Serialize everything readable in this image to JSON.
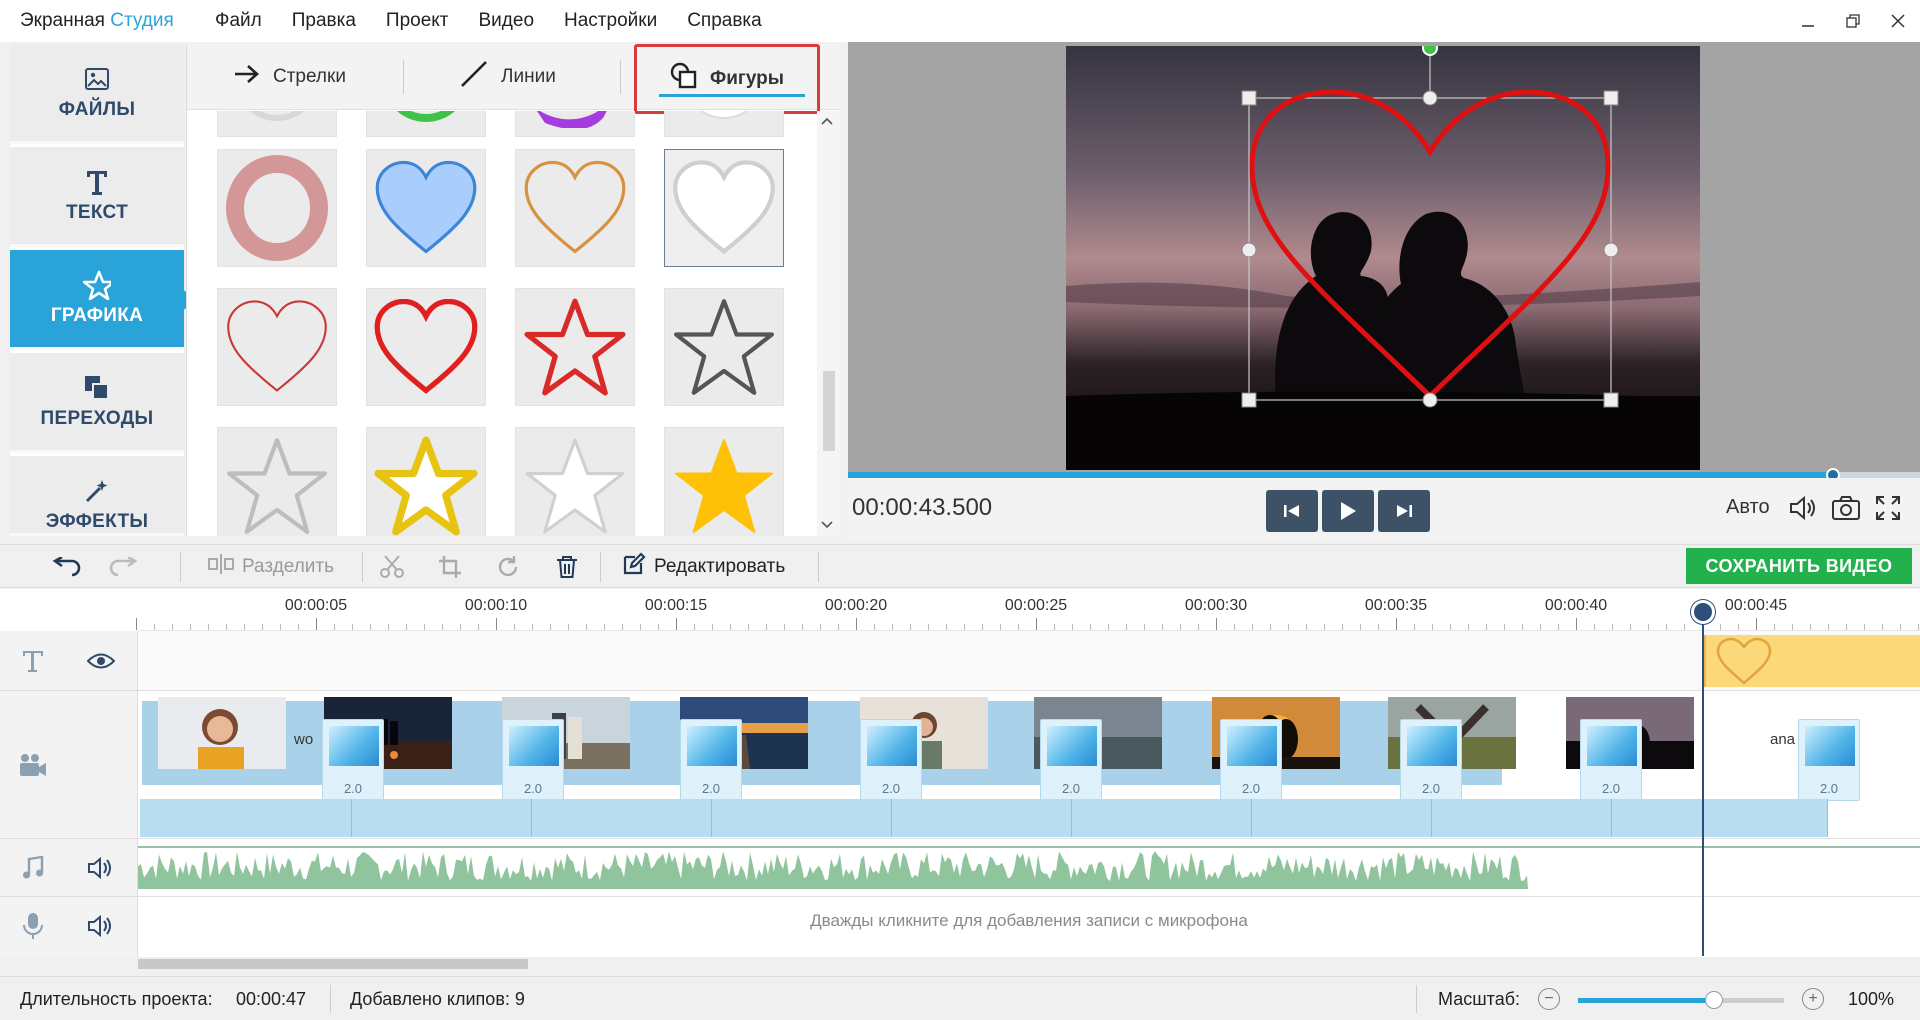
{
  "app": {
    "brand_main": "Экранная",
    "brand_accent": "Студия"
  },
  "menu": [
    "Файл",
    "Правка",
    "Проект",
    "Видео",
    "Настройки",
    "Справка"
  ],
  "sidebar": {
    "items": [
      {
        "label": "ФАЙЛЫ",
        "icon": "image-icon",
        "active": false
      },
      {
        "label": "ТЕКСТ",
        "icon": "text-icon",
        "active": false
      },
      {
        "label": "ГРАФИКА",
        "icon": "star-icon",
        "active": true
      },
      {
        "label": "ПЕРЕХОДЫ",
        "icon": "transitions-icon",
        "active": false
      },
      {
        "label": "ЭФФЕКТЫ",
        "icon": "magic-wand-icon",
        "active": false
      }
    ]
  },
  "graphics_tabs": [
    {
      "label": "Стрелки",
      "icon": "arrow-right-icon"
    },
    {
      "label": "Линии",
      "icon": "line-icon"
    },
    {
      "label": "Фигуры",
      "icon": "shapes-icon",
      "active": true
    }
  ],
  "preview": {
    "timecode": "00:00:43.500",
    "quality_label": "Авто",
    "progress": 0.919
  },
  "toolbar": {
    "split_label": "Разделить",
    "edit_label": "Редактировать",
    "save_label": "СОХРАНИТЬ ВИДЕО"
  },
  "timeline": {
    "ticks": [
      "00:00:05",
      "00:00:10",
      "00:00:15",
      "00:00:20",
      "00:00:25",
      "00:00:30",
      "00:00:35",
      "00:00:40",
      "00:00:45"
    ],
    "transition_duration": "2.0",
    "clip_text_1": "wo",
    "clip_text_2": "ana",
    "mic_hint": "Дважды кликните для добавления записи с микрофона"
  },
  "status": {
    "duration_label": "Длительность проекта:",
    "duration_value": "00:00:47",
    "clips_label": "Добавлено клипов: 9",
    "zoom_label": "Масштаб:",
    "zoom_value": "100%",
    "zoom_level": 0.66
  },
  "colors": {
    "accent": "#2aa4d8",
    "save": "#22b14c",
    "highlight": "#d63c3c",
    "heart": "#e01010"
  }
}
